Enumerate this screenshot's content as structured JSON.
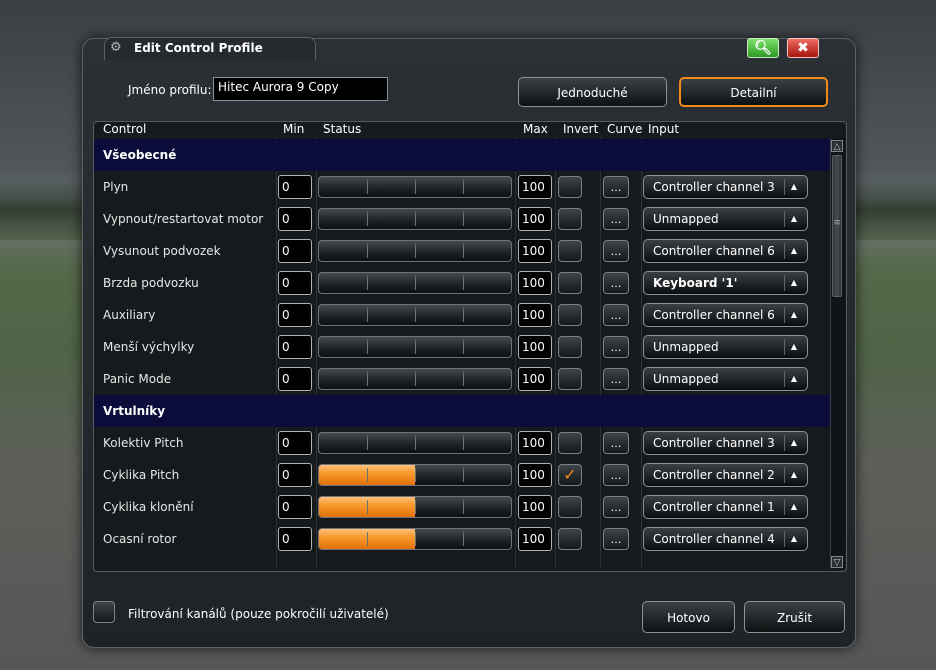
{
  "window": {
    "title": "Edit Control Profile",
    "title_icon": "gear-icon",
    "search_icon": "search-icon",
    "close_icon": "close-icon"
  },
  "profile": {
    "name_label": "Jméno profilu:",
    "name_value": "Hitec Aurora 9 Copy"
  },
  "mode_buttons": {
    "simple": "Jednoduché",
    "detailed": "Detailní",
    "accent_color": "#f08a19"
  },
  "columns": {
    "control": "Control",
    "min": "Min",
    "status": "Status",
    "max": "Max",
    "invert": "Invert",
    "curve": "Curve",
    "input": "Input"
  },
  "sections": [
    {
      "title": "Všeobecné",
      "rows": [
        {
          "label": "Plyn",
          "min": "0",
          "max": "100",
          "status_pct": 0,
          "invert": false,
          "curve": "...",
          "input": "Controller channel 3",
          "bold": false
        },
        {
          "label": "Vypnout/restartovat motor",
          "min": "0",
          "max": "100",
          "status_pct": 0,
          "invert": false,
          "curve": "...",
          "input": "Unmapped",
          "bold": false
        },
        {
          "label": "Vysunout podvozek",
          "min": "0",
          "max": "100",
          "status_pct": 0,
          "invert": false,
          "curve": "...",
          "input": "Controller channel 6",
          "bold": false
        },
        {
          "label": "Brzda podvozku",
          "min": "0",
          "max": "100",
          "status_pct": 0,
          "invert": false,
          "curve": "...",
          "input": "Keyboard '1'",
          "bold": true
        },
        {
          "label": "Auxiliary",
          "min": "0",
          "max": "100",
          "status_pct": 0,
          "invert": false,
          "curve": "...",
          "input": "Controller channel 6",
          "bold": false
        },
        {
          "label": "Menší výchylky",
          "min": "0",
          "max": "100",
          "status_pct": 0,
          "invert": false,
          "curve": "...",
          "input": "Unmapped",
          "bold": false
        },
        {
          "label": "Panic Mode",
          "min": "0",
          "max": "100",
          "status_pct": 0,
          "invert": false,
          "curve": "...",
          "input": "Unmapped",
          "bold": false
        }
      ]
    },
    {
      "title": "Vrtulníky",
      "rows": [
        {
          "label": "Kolektiv Pitch",
          "min": "0",
          "max": "100",
          "status_pct": 0,
          "invert": false,
          "curve": "...",
          "input": "Controller channel 3",
          "bold": false
        },
        {
          "label": "Cyklika Pitch",
          "min": "0",
          "max": "100",
          "status_pct": 50,
          "invert": true,
          "curve": "...",
          "input": "Controller channel 2",
          "bold": false
        },
        {
          "label": "Cyklika klonění",
          "min": "0",
          "max": "100",
          "status_pct": 50,
          "invert": false,
          "curve": "...",
          "input": "Controller channel 1",
          "bold": false
        },
        {
          "label": "Ocasní rotor",
          "min": "0",
          "max": "100",
          "status_pct": 50,
          "invert": false,
          "curve": "...",
          "input": "Controller channel 4",
          "bold": false
        }
      ]
    }
  ],
  "footer": {
    "filter_label": "Filtrování kanálů (pouze pokročilí uživatelé)",
    "done_button": "Hotovo",
    "cancel_button": "Zrušit"
  }
}
